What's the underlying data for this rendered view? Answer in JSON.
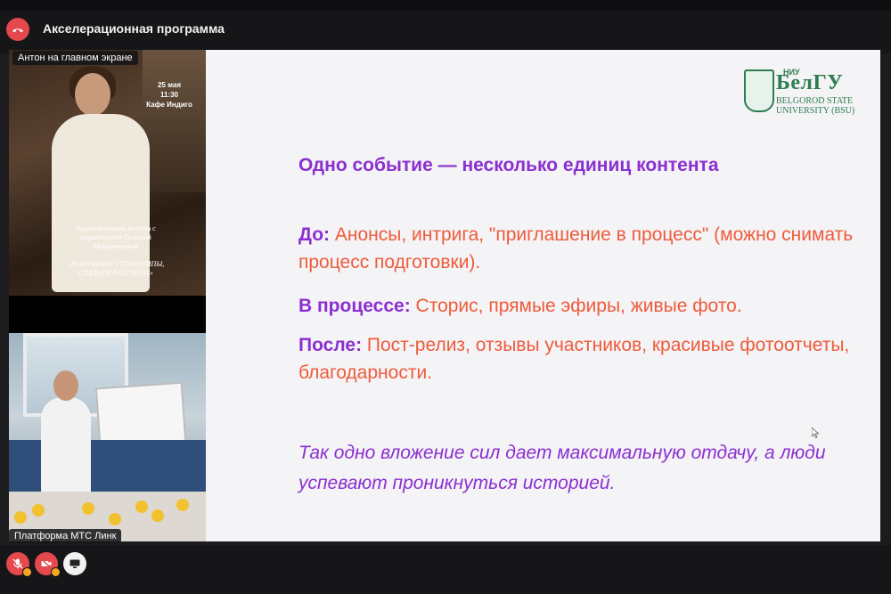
{
  "window": {
    "title": "Акселерационная программа"
  },
  "tiles": [
    {
      "label": "Антон на главном экране"
    },
    {
      "label": "Платформа МТС Линк"
    }
  ],
  "poster": {
    "date_lines": [
      "25 мая",
      "11:30",
      "Кафе Индиго"
    ],
    "event_text": "Вдохновляющая встреча с маркетологом Полиной Мордвинцевой",
    "slogan": "«РАЗРУШАЕМ СТЕРЕОТИПЫ, СОЗДАЁМ РЕЗУЛЬТАТ»"
  },
  "slide": {
    "logo": {
      "niu": "НИУ",
      "main": "БелГУ",
      "sub1": "BELGOROD STATE",
      "sub2": "UNIVERSITY (BSU)"
    },
    "heading": "Одно событие — несколько единиц контента",
    "items": [
      {
        "label": "До:",
        "text": " Анонсы, интрига, \"приглашение в процесс\" (можно снимать процесс подготовки)."
      },
      {
        "label": "В процессе:",
        "text": " Сторис, прямые эфиры, живые фото."
      },
      {
        "label": "После:",
        "text": " Пост-релиз, отзывы участников, красивые фотоотчеты, благодарности."
      }
    ],
    "closing": "Так одно вложение сил дает максимальную отдачу, а люди успевают проникнуться историей."
  },
  "controls": {
    "leave_icon": "phone-hangup-icon",
    "mic_icon": "mic-off-icon",
    "camera_icon": "camera-off-icon",
    "share_icon": "screen-share-icon"
  },
  "colors": {
    "accent_purple": "#8b2fd1",
    "accent_orange": "#ef5b3a",
    "danger": "#e5484d",
    "brand_green": "#2e7d4f"
  }
}
